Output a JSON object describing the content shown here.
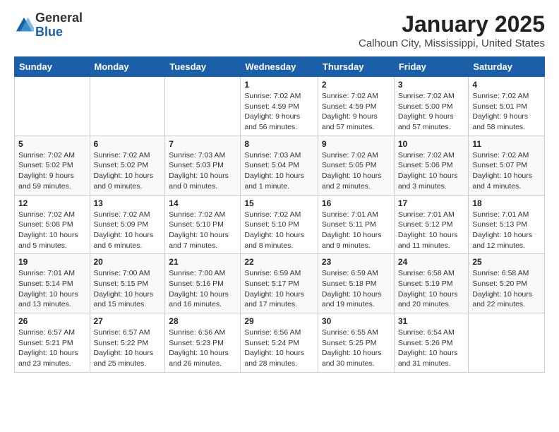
{
  "logo": {
    "general": "General",
    "blue": "Blue"
  },
  "header": {
    "title": "January 2025",
    "subtitle": "Calhoun City, Mississippi, United States"
  },
  "weekdays": [
    "Sunday",
    "Monday",
    "Tuesday",
    "Wednesday",
    "Thursday",
    "Friday",
    "Saturday"
  ],
  "weeks": [
    [
      {
        "day": "",
        "sunrise": "",
        "sunset": "",
        "daylight": ""
      },
      {
        "day": "",
        "sunrise": "",
        "sunset": "",
        "daylight": ""
      },
      {
        "day": "",
        "sunrise": "",
        "sunset": "",
        "daylight": ""
      },
      {
        "day": "1",
        "sunrise": "Sunrise: 7:02 AM",
        "sunset": "Sunset: 4:59 PM",
        "daylight": "Daylight: 9 hours and 56 minutes."
      },
      {
        "day": "2",
        "sunrise": "Sunrise: 7:02 AM",
        "sunset": "Sunset: 4:59 PM",
        "daylight": "Daylight: 9 hours and 57 minutes."
      },
      {
        "day": "3",
        "sunrise": "Sunrise: 7:02 AM",
        "sunset": "Sunset: 5:00 PM",
        "daylight": "Daylight: 9 hours and 57 minutes."
      },
      {
        "day": "4",
        "sunrise": "Sunrise: 7:02 AM",
        "sunset": "Sunset: 5:01 PM",
        "daylight": "Daylight: 9 hours and 58 minutes."
      }
    ],
    [
      {
        "day": "5",
        "sunrise": "Sunrise: 7:02 AM",
        "sunset": "Sunset: 5:02 PM",
        "daylight": "Daylight: 9 hours and 59 minutes."
      },
      {
        "day": "6",
        "sunrise": "Sunrise: 7:02 AM",
        "sunset": "Sunset: 5:02 PM",
        "daylight": "Daylight: 10 hours and 0 minutes."
      },
      {
        "day": "7",
        "sunrise": "Sunrise: 7:03 AM",
        "sunset": "Sunset: 5:03 PM",
        "daylight": "Daylight: 10 hours and 0 minutes."
      },
      {
        "day": "8",
        "sunrise": "Sunrise: 7:03 AM",
        "sunset": "Sunset: 5:04 PM",
        "daylight": "Daylight: 10 hours and 1 minute."
      },
      {
        "day": "9",
        "sunrise": "Sunrise: 7:02 AM",
        "sunset": "Sunset: 5:05 PM",
        "daylight": "Daylight: 10 hours and 2 minutes."
      },
      {
        "day": "10",
        "sunrise": "Sunrise: 7:02 AM",
        "sunset": "Sunset: 5:06 PM",
        "daylight": "Daylight: 10 hours and 3 minutes."
      },
      {
        "day": "11",
        "sunrise": "Sunrise: 7:02 AM",
        "sunset": "Sunset: 5:07 PM",
        "daylight": "Daylight: 10 hours and 4 minutes."
      }
    ],
    [
      {
        "day": "12",
        "sunrise": "Sunrise: 7:02 AM",
        "sunset": "Sunset: 5:08 PM",
        "daylight": "Daylight: 10 hours and 5 minutes."
      },
      {
        "day": "13",
        "sunrise": "Sunrise: 7:02 AM",
        "sunset": "Sunset: 5:09 PM",
        "daylight": "Daylight: 10 hours and 6 minutes."
      },
      {
        "day": "14",
        "sunrise": "Sunrise: 7:02 AM",
        "sunset": "Sunset: 5:10 PM",
        "daylight": "Daylight: 10 hours and 7 minutes."
      },
      {
        "day": "15",
        "sunrise": "Sunrise: 7:02 AM",
        "sunset": "Sunset: 5:10 PM",
        "daylight": "Daylight: 10 hours and 8 minutes."
      },
      {
        "day": "16",
        "sunrise": "Sunrise: 7:01 AM",
        "sunset": "Sunset: 5:11 PM",
        "daylight": "Daylight: 10 hours and 9 minutes."
      },
      {
        "day": "17",
        "sunrise": "Sunrise: 7:01 AM",
        "sunset": "Sunset: 5:12 PM",
        "daylight": "Daylight: 10 hours and 11 minutes."
      },
      {
        "day": "18",
        "sunrise": "Sunrise: 7:01 AM",
        "sunset": "Sunset: 5:13 PM",
        "daylight": "Daylight: 10 hours and 12 minutes."
      }
    ],
    [
      {
        "day": "19",
        "sunrise": "Sunrise: 7:01 AM",
        "sunset": "Sunset: 5:14 PM",
        "daylight": "Daylight: 10 hours and 13 minutes."
      },
      {
        "day": "20",
        "sunrise": "Sunrise: 7:00 AM",
        "sunset": "Sunset: 5:15 PM",
        "daylight": "Daylight: 10 hours and 15 minutes."
      },
      {
        "day": "21",
        "sunrise": "Sunrise: 7:00 AM",
        "sunset": "Sunset: 5:16 PM",
        "daylight": "Daylight: 10 hours and 16 minutes."
      },
      {
        "day": "22",
        "sunrise": "Sunrise: 6:59 AM",
        "sunset": "Sunset: 5:17 PM",
        "daylight": "Daylight: 10 hours and 17 minutes."
      },
      {
        "day": "23",
        "sunrise": "Sunrise: 6:59 AM",
        "sunset": "Sunset: 5:18 PM",
        "daylight": "Daylight: 10 hours and 19 minutes."
      },
      {
        "day": "24",
        "sunrise": "Sunrise: 6:58 AM",
        "sunset": "Sunset: 5:19 PM",
        "daylight": "Daylight: 10 hours and 20 minutes."
      },
      {
        "day": "25",
        "sunrise": "Sunrise: 6:58 AM",
        "sunset": "Sunset: 5:20 PM",
        "daylight": "Daylight: 10 hours and 22 minutes."
      }
    ],
    [
      {
        "day": "26",
        "sunrise": "Sunrise: 6:57 AM",
        "sunset": "Sunset: 5:21 PM",
        "daylight": "Daylight: 10 hours and 23 minutes."
      },
      {
        "day": "27",
        "sunrise": "Sunrise: 6:57 AM",
        "sunset": "Sunset: 5:22 PM",
        "daylight": "Daylight: 10 hours and 25 minutes."
      },
      {
        "day": "28",
        "sunrise": "Sunrise: 6:56 AM",
        "sunset": "Sunset: 5:23 PM",
        "daylight": "Daylight: 10 hours and 26 minutes."
      },
      {
        "day": "29",
        "sunrise": "Sunrise: 6:56 AM",
        "sunset": "Sunset: 5:24 PM",
        "daylight": "Daylight: 10 hours and 28 minutes."
      },
      {
        "day": "30",
        "sunrise": "Sunrise: 6:55 AM",
        "sunset": "Sunset: 5:25 PM",
        "daylight": "Daylight: 10 hours and 30 minutes."
      },
      {
        "day": "31",
        "sunrise": "Sunrise: 6:54 AM",
        "sunset": "Sunset: 5:26 PM",
        "daylight": "Daylight: 10 hours and 31 minutes."
      },
      {
        "day": "",
        "sunrise": "",
        "sunset": "",
        "daylight": ""
      }
    ]
  ]
}
